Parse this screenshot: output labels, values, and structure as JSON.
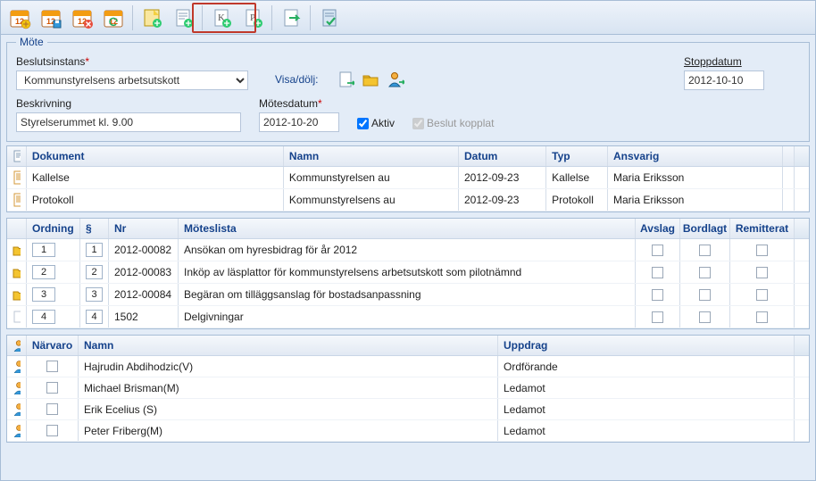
{
  "panel": {
    "title": "Möte"
  },
  "labels": {
    "beslutsinstans": "Beslutsinstans",
    "beskrivning": "Beskrivning",
    "motesdatum": "Mötesdatum",
    "stoppdatum": "Stoppdatum",
    "visa": "Visa/dölj:",
    "aktiv": "Aktiv",
    "beslut": "Beslut kopplat"
  },
  "fields": {
    "beslutsinstans": "Kommunstyrelsens arbetsutskott",
    "beskrivning": "Styrelserummet kl. 9.00",
    "motesdatum": "2012-10-20",
    "stoppdatum": "2012-10-10",
    "aktiv_checked": true,
    "beslut_checked": true
  },
  "docGrid": {
    "headers": {
      "dokument": "Dokument",
      "namn": "Namn",
      "datum": "Datum",
      "typ": "Typ",
      "ansvarig": "Ansvarig"
    },
    "rows": [
      {
        "dokument": "Kallelse",
        "namn": "Kommunstyrelsen au",
        "datum": "2012-09-23",
        "typ": "Kallelse",
        "ansvarig": "Maria Eriksson"
      },
      {
        "dokument": "Protokoll",
        "namn": "Kommunstyrelsens au",
        "datum": "2012-09-23",
        "typ": "Protokoll",
        "ansvarig": "Maria Eriksson"
      }
    ]
  },
  "orderGrid": {
    "headers": {
      "ordning": "Ordning",
      "s": "§",
      "nr": "Nr",
      "lista": "Möteslista",
      "avslag": "Avslag",
      "bordlagt": "Bordlagt",
      "remitterat": "Remitterat"
    },
    "rows": [
      {
        "ordning": "1",
        "s": "1",
        "nr": "2012-00082",
        "lista": "Ansökan om hyresbidrag för år 2012",
        "folder": true
      },
      {
        "ordning": "2",
        "s": "2",
        "nr": "2012-00083",
        "lista": "Inköp av läsplattor för kommunstyrelsens arbetsutskott som pilotnämnd",
        "folder": true
      },
      {
        "ordning": "3",
        "s": "3",
        "nr": "2012-00084",
        "lista": "Begäran om tilläggsanslag för bostadsanpassning",
        "folder": true
      },
      {
        "ordning": "4",
        "s": "4",
        "nr": "1502",
        "lista": "Delgivningar",
        "folder": false
      }
    ]
  },
  "attendGrid": {
    "headers": {
      "narvaro": "Närvaro",
      "namn": "Namn",
      "uppdrag": "Uppdrag"
    },
    "rows": [
      {
        "namn": "Hajrudin Abdihodzic(V)",
        "uppdrag": "Ordförande"
      },
      {
        "namn": "Michael Brisman(M)",
        "uppdrag": "Ledamot"
      },
      {
        "namn": "Erik Ecelius (S)",
        "uppdrag": "Ledamot"
      },
      {
        "namn": "Peter Friberg(M)",
        "uppdrag": "Ledamot"
      }
    ]
  }
}
